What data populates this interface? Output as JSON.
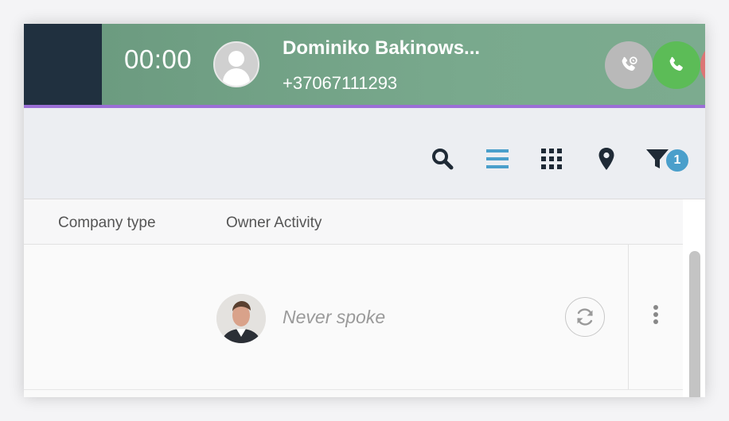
{
  "call": {
    "timer": "00:00",
    "caller_name": "Dominiko Bakinows...",
    "caller_phone": "+37067111293",
    "colors": {
      "bar": "#79a98d",
      "answer": "#5cbc57",
      "hangup": "#dc7575",
      "transfer": "#b9b9b9",
      "underline": "#9b6fd6"
    }
  },
  "toolbar": {
    "icons": [
      "search-icon",
      "list-view-icon",
      "grid-view-icon",
      "map-pin-icon",
      "filter-icon"
    ],
    "filter_count": "1"
  },
  "table": {
    "columns": [
      "Company type",
      "Owner Activity"
    ],
    "rows": [
      {
        "owner_activity": "Never spoke"
      }
    ]
  }
}
